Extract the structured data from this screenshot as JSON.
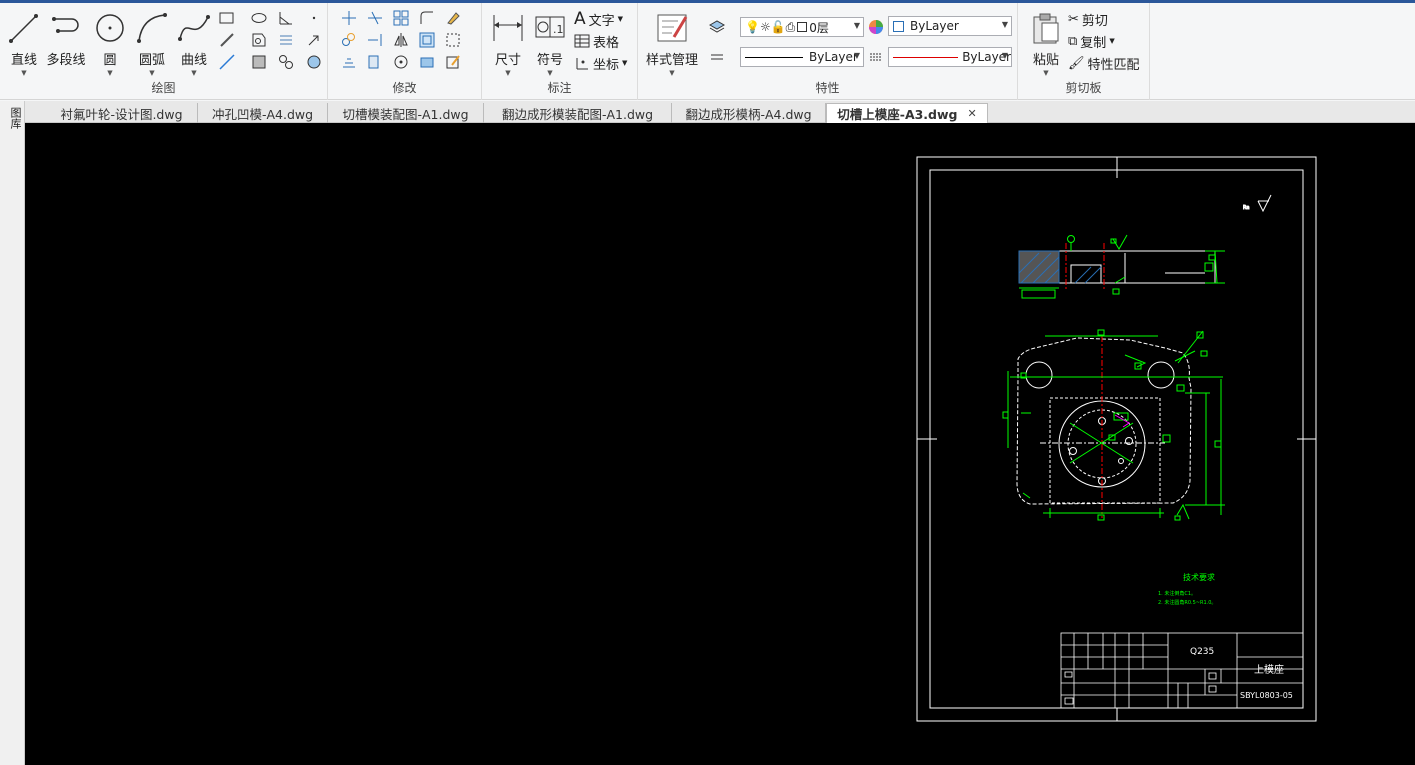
{
  "ribbon": {
    "draw_group": {
      "label": "绘图",
      "line": "直线",
      "polyline": "多段线",
      "circle": "圆",
      "arc": "圆弧",
      "curve": "曲线"
    },
    "modify_group": {
      "label": "修改"
    },
    "annotate_group": {
      "label": "标注",
      "dimension": "尺寸",
      "symbol": "符号",
      "text": "文字",
      "table": "表格",
      "coordinate": "坐标"
    },
    "properties_group": {
      "label": "特性",
      "style_manager": "样式管理",
      "layer": "0层",
      "color": "ByLayer",
      "linetype": "ByLayer",
      "lineweight": "ByLayer"
    },
    "clipboard_group": {
      "label": "剪切板",
      "paste": "粘贴",
      "cut": "剪切",
      "copy": "复制",
      "match_props": "特性匹配"
    }
  },
  "sidebar": {
    "label": "图库"
  },
  "tabs": [
    {
      "label": "衬氟叶轮-设计图.dwg"
    },
    {
      "label": "冲孔凹模-A4.dwg"
    },
    {
      "label": "切槽模装配图-A1.dwg"
    },
    {
      "label": "翻边成形模装配图-A1.dwg"
    },
    {
      "label": "翻边成形模柄-A4.dwg"
    },
    {
      "label": "切槽上模座-A3.dwg",
      "active": true
    }
  ],
  "drawing": {
    "tech_title": "技术要求",
    "tech_line1": "1. 未注倒角C1。",
    "tech_line2": "2. 未注圆角R0.5~R1.0。",
    "material": "Q235",
    "part_name": "上模座",
    "drawing_no": "SBYL0803-05"
  },
  "colors": {
    "canvas": "#000000",
    "ribbon": "#f5f6f7",
    "active_tab": "#ffffff",
    "cad_white": "#ffffff",
    "cad_green": "#00ff00",
    "cad_red": "#ff0000",
    "cad_magenta": "#ff00ff"
  }
}
